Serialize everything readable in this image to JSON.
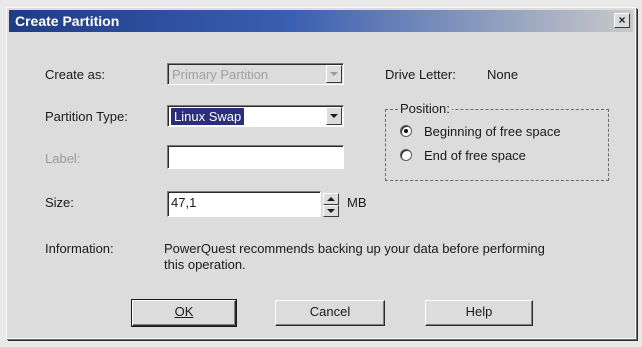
{
  "window": {
    "title": "Create Partition",
    "close_glyph": "×"
  },
  "form": {
    "create_as": {
      "label": "Create as:",
      "value": "Primary Partition",
      "enabled": false
    },
    "drive_letter": {
      "label": "Drive Letter:",
      "value": "None"
    },
    "partition_type": {
      "label": "Partition Type:",
      "value": "Linux Swap"
    },
    "label_field": {
      "label": "Label:",
      "value": "",
      "enabled": false
    },
    "size": {
      "label": "Size:",
      "value": "47,1",
      "unit": "MB"
    },
    "information": {
      "label": "Information:",
      "text_line1": "PowerQuest recommends backing up your data before performing",
      "text_line2": "this operation."
    }
  },
  "position": {
    "title": "Position:",
    "options": [
      {
        "label": "Beginning of free space",
        "checked": true
      },
      {
        "label": "End of free space",
        "checked": false
      }
    ]
  },
  "buttons": {
    "ok": "OK",
    "cancel": "Cancel",
    "help": "Help"
  },
  "colors": {
    "title_bar": "#1f3c86",
    "selection": "#2b2e7a",
    "face": "#dcdcdc"
  }
}
